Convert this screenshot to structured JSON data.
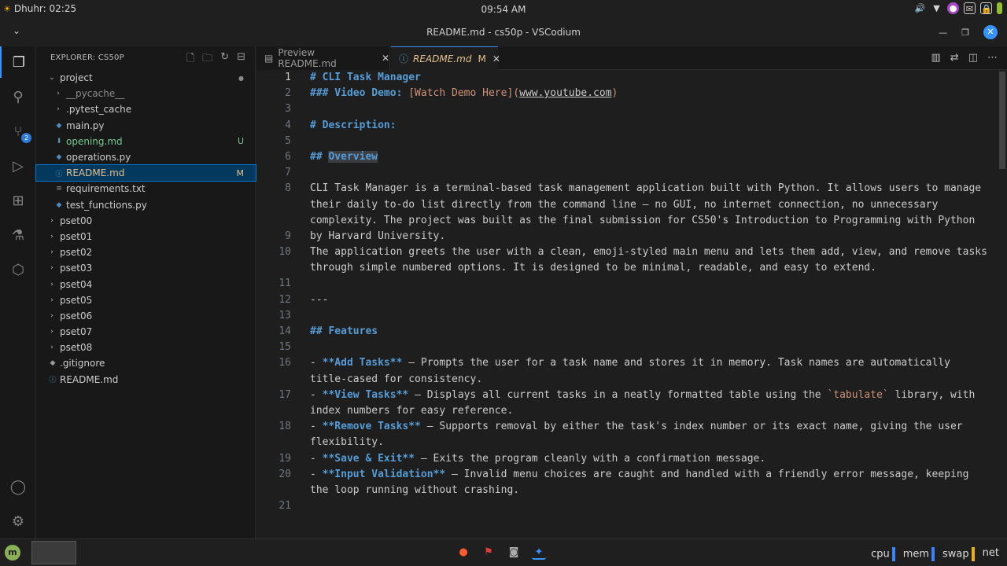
{
  "system_bar": {
    "prayer": "Dhuhr: 02:25",
    "clock": "09:54 AM"
  },
  "window": {
    "title": "README.md - cs50p - VSCodium"
  },
  "activity_bar": {
    "scm_badge": "2"
  },
  "explorer": {
    "header": "EXPLORER: CS50P",
    "root": "project",
    "items": [
      {
        "label": "__pycache__",
        "status": "",
        "kind": "folder-nested"
      },
      {
        "label": ".pytest_cache",
        "status": "",
        "kind": "folder-nested"
      },
      {
        "label": "main.py",
        "status": "",
        "kind": "py"
      },
      {
        "label": "opening.md",
        "status": "U",
        "kind": "md"
      },
      {
        "label": "operations.py",
        "status": "",
        "kind": "py"
      },
      {
        "label": "README.md",
        "status": "M",
        "kind": "md"
      },
      {
        "label": "requirements.txt",
        "status": "",
        "kind": "txt"
      },
      {
        "label": "test_functions.py",
        "status": "",
        "kind": "py"
      }
    ],
    "folders": [
      "pset00",
      "pset01",
      "pset02",
      "pset03",
      "pset04",
      "pset05",
      "pset06",
      "pset07",
      "pset08"
    ],
    "root_files": [
      ".gitignore",
      "README.md"
    ]
  },
  "tabs": [
    {
      "label": "Preview README.md",
      "modified": ""
    },
    {
      "label": "README.md",
      "modified": "M"
    }
  ],
  "code": {
    "lines": [
      {
        "n": "1",
        "parts": [
          [
            "h",
            "# CLI Task Manager"
          ]
        ]
      },
      {
        "n": "2",
        "parts": [
          [
            "h",
            "### Video Demo: "
          ],
          [
            "link",
            "[Watch Demo Here]"
          ],
          [
            "link",
            "("
          ],
          [
            "url",
            "www.youtube.com"
          ],
          [
            "link",
            ")"
          ]
        ]
      },
      {
        "n": "3",
        "parts": []
      },
      {
        "n": "4",
        "parts": [
          [
            "h",
            "# Description:"
          ]
        ]
      },
      {
        "n": "5",
        "parts": []
      },
      {
        "n": "6",
        "parts": [
          [
            "h",
            "## "
          ],
          [
            "hl",
            "Overview"
          ]
        ]
      },
      {
        "n": "7",
        "parts": []
      },
      {
        "n": "8",
        "parts": [
          [
            "t",
            "CLI Task Manager is a terminal-based task management application built with Python. It allows users to manage their daily to-do list directly from the command line — no GUI, no internet connection, no unnecessary complexity. The project was built as the final submission for CS50's Introduction to Programming with Python by Harvard University."
          ]
        ]
      },
      {
        "n": "9",
        "parts": []
      },
      {
        "n": "10",
        "parts": [
          [
            "t",
            "The application greets the user with a clean, emoji-styled main menu and lets them add, view, and remove tasks through simple numbered options. It is designed to be minimal, readable, and easy to extend."
          ]
        ]
      },
      {
        "n": "11",
        "parts": []
      },
      {
        "n": "12",
        "parts": [
          [
            "t",
            "---"
          ]
        ]
      },
      {
        "n": "13",
        "parts": []
      },
      {
        "n": "14",
        "parts": [
          [
            "h",
            "## Features"
          ]
        ]
      },
      {
        "n": "15",
        "parts": []
      },
      {
        "n": "16",
        "parts": [
          [
            "t",
            "- "
          ],
          [
            "b",
            "**Add Tasks**"
          ],
          [
            "t",
            " — Prompts the user for a task name and stores it in memory. Task names are automatically title-cased for consistency."
          ]
        ]
      },
      {
        "n": "17",
        "parts": [
          [
            "t",
            "- "
          ],
          [
            "b",
            "**View Tasks**"
          ],
          [
            "t",
            " — Displays all current tasks in a neatly formatted table using the "
          ],
          [
            "code",
            "`tabulate`"
          ],
          [
            "t",
            " library, with index numbers for easy reference."
          ]
        ]
      },
      {
        "n": "18",
        "parts": [
          [
            "t",
            "- "
          ],
          [
            "b",
            "**Remove Tasks**"
          ],
          [
            "t",
            " — Supports removal by either the task's index number or its exact name, giving the user flexibility."
          ]
        ]
      },
      {
        "n": "19",
        "parts": [
          [
            "t",
            "- "
          ],
          [
            "b",
            "**Save & Exit**"
          ],
          [
            "t",
            " — Exits the program cleanly with a confirmation message."
          ]
        ]
      },
      {
        "n": "20",
        "parts": [
          [
            "t",
            "- "
          ],
          [
            "b",
            "**Input Validation**"
          ],
          [
            "t",
            " — Invalid menu choices are caught and handled with a friendly error message, keeping the loop running without crashing."
          ]
        ]
      },
      {
        "n": "21",
        "parts": []
      }
    ]
  },
  "taskbar": {
    "monitors": [
      "cpu",
      "mem",
      "swap",
      "net"
    ]
  },
  "colors": {
    "accent": "#3794ff",
    "git_untracked": "#73c991",
    "git_modified": "#e2c08d",
    "selection": "#04395e"
  }
}
